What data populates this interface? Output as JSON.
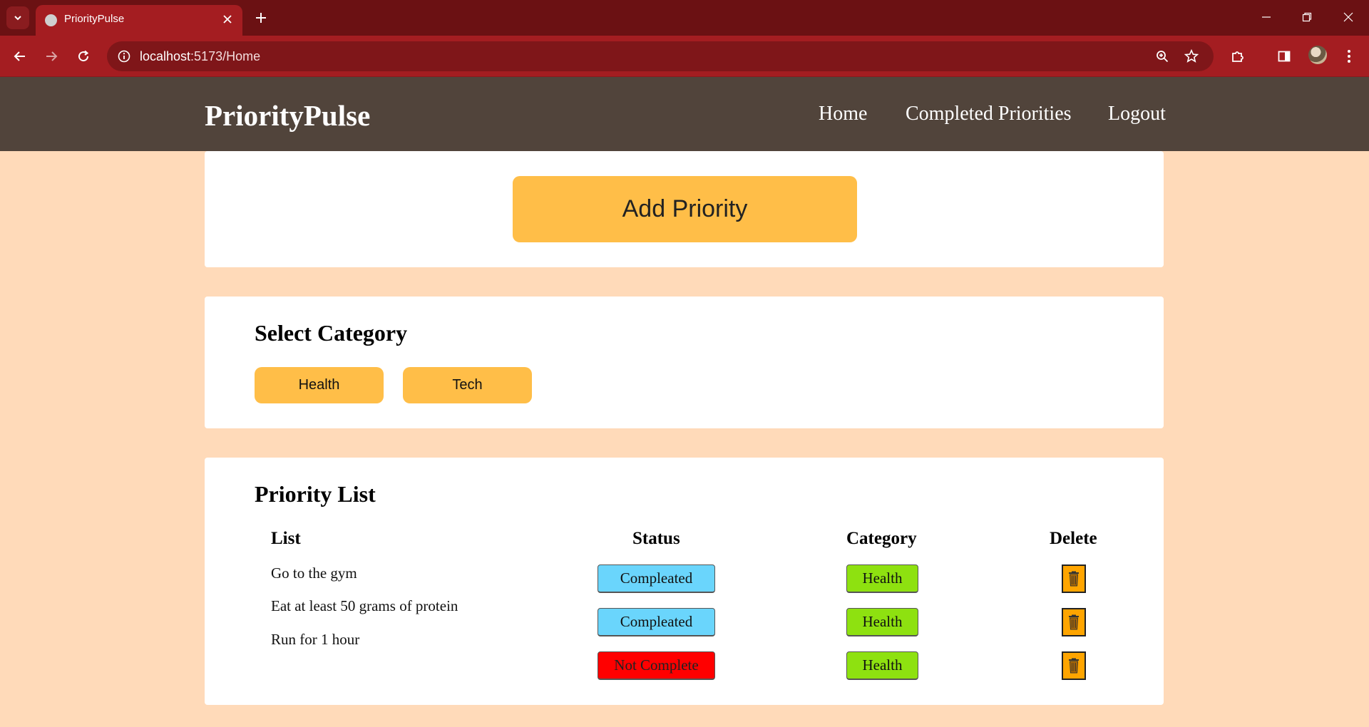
{
  "browser": {
    "tab_title": "PriorityPulse",
    "url_host": "localhost",
    "url_path": ":5173/Home"
  },
  "navbar": {
    "brand": "PriorityPulse",
    "links": [
      "Home",
      "Completed Priorities",
      "Logout"
    ]
  },
  "add_section": {
    "button_label": "Add Priority"
  },
  "category_section": {
    "title": "Select Category",
    "categories": [
      "Health",
      "Tech"
    ]
  },
  "priority_list": {
    "title": "Priority List",
    "headers": {
      "list": "List",
      "status": "Status",
      "category": "Category",
      "delete": "Delete"
    },
    "items": [
      {
        "text": "Go to the gym",
        "status": "Compleated",
        "category": "Health"
      },
      {
        "text": "Eat at least 50 grams of protein",
        "status": "Compleated",
        "category": "Health"
      },
      {
        "text": "Run for 1 hour",
        "status": "Not Complete",
        "category": "Health"
      }
    ]
  },
  "colors": {
    "page_bg": "#ffdab9",
    "navbar_bg": "#51443b",
    "accent_button": "#ffbe48",
    "status_done": "#6ad5fc",
    "status_not_complete": "#ff0000",
    "category_tag": "#8ee110",
    "delete_button": "#ffa500",
    "browser_frame": "#a41d21"
  },
  "icons": {
    "tab_menu": "chevron-down-icon",
    "favicon": "globe-icon",
    "tab_close": "close-icon",
    "new_tab": "plus-icon",
    "back": "arrow-left-icon",
    "forward": "arrow-right-icon",
    "reload": "reload-icon",
    "site_info": "info-icon",
    "zoom": "zoom-icon",
    "bookmark": "star-icon",
    "extensions": "puzzle-icon",
    "side_panel": "side-panel-icon",
    "menu": "kebab-menu-icon",
    "delete": "trash-icon"
  }
}
